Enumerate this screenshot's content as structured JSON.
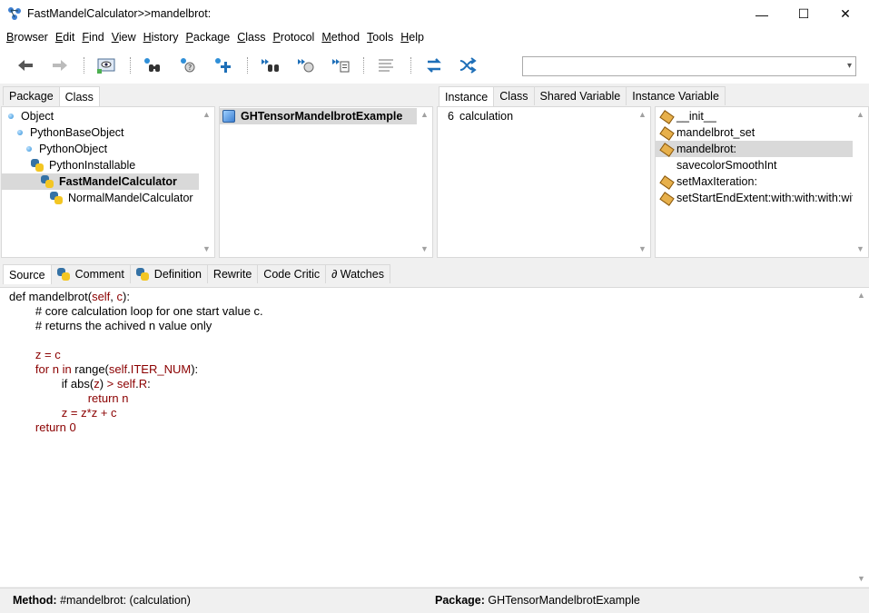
{
  "window": {
    "title": "FastMandelCalculator>>mandelbrot:",
    "controls": {
      "minimize": "—",
      "maximize": "☐",
      "close": "✕"
    }
  },
  "menu": [
    {
      "label": "Browser",
      "underline": "B",
      "rest": "rowser"
    },
    {
      "label": "Edit",
      "underline": "E",
      "rest": "dit"
    },
    {
      "label": "Find",
      "underline": "F",
      "rest": "ind"
    },
    {
      "label": "View",
      "underline": "V",
      "rest": "iew"
    },
    {
      "label": "History",
      "underline": "H",
      "rest": "istory"
    },
    {
      "label": "Package",
      "underline": "P",
      "rest": "ackage"
    },
    {
      "label": "Class",
      "underline": "C",
      "rest": "lass"
    },
    {
      "label": "Protocol",
      "underline": "P",
      "rest": "rotocol"
    },
    {
      "label": "Method",
      "underline": "M",
      "rest": "ethod"
    },
    {
      "label": "Tools",
      "underline": "T",
      "rest": "ools"
    },
    {
      "label": "Help",
      "underline": "H",
      "rest": "elp"
    }
  ],
  "toolbar": {
    "icons": [
      "back-icon",
      "forward-icon",
      "browse-icon",
      "find-class-icon",
      "find-method-icon",
      "new-class-icon",
      "senders-icon",
      "implementors-icon",
      "references-icon",
      "format-icon",
      "refresh-icon",
      "shuffle-icon"
    ],
    "search_value": ""
  },
  "left_tabs": [
    "Package",
    "Class"
  ],
  "right_tabs": [
    "Instance",
    "Class",
    "Shared Variable",
    "Instance Variable"
  ],
  "class_tree": [
    {
      "label": "Object",
      "icon": "bullet",
      "indent": 0
    },
    {
      "label": "PythonBaseObject",
      "icon": "bullet",
      "indent": 1
    },
    {
      "label": "PythonObject",
      "icon": "bullet",
      "indent": 2
    },
    {
      "label": "PythonInstallable",
      "icon": "python",
      "indent": 3
    },
    {
      "label": "FastMandelCalculator",
      "icon": "python",
      "indent": 4,
      "selected": true
    },
    {
      "label": "NormalMandelCalculator",
      "icon": "python",
      "indent": 5
    }
  ],
  "packages": [
    {
      "label": "GHTensorMandelbrotExample",
      "selected": true
    }
  ],
  "categories": [
    {
      "count": "6",
      "label": "calculation"
    }
  ],
  "methods": [
    {
      "label": "__init__",
      "icon": true
    },
    {
      "label": "mandelbrot_set",
      "icon": true
    },
    {
      "label": "mandelbrot:",
      "icon": true,
      "selected": true
    },
    {
      "label": "savecolorSmoothInt",
      "icon": false
    },
    {
      "label": "setMaxIteration:",
      "icon": true
    },
    {
      "label": "setStartEndExtent:with:with:with:with",
      "icon": true
    }
  ],
  "bottom_tabs": [
    "Source",
    "Comment",
    "Definition",
    "Rewrite",
    "Code Critic",
    "∂ Watches"
  ],
  "source": {
    "lines": [
      "def mandelbrot(self, c):",
      "\t# core calculation loop for one start value c.",
      "\t# returns the achived n value only",
      "",
      "\tz = c",
      "\tfor n in range(self.ITER_NUM):",
      "\t\tif abs(z) > self.R:",
      "\t\t\treturn n",
      "\t\tz = z*z + c",
      "\treturn 0"
    ]
  },
  "status": {
    "method_label": "Method:",
    "method_value": "#mandelbrot: (calculation)",
    "package_label": "Package:",
    "package_value": "GHTensorMandelbrotExample"
  }
}
